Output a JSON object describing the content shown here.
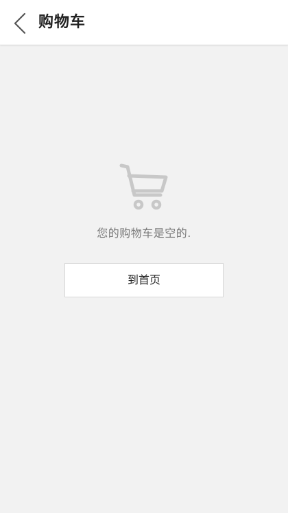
{
  "header": {
    "back_icon": "chevron-left-icon",
    "title": "购物车"
  },
  "empty_state": {
    "icon": "cart-icon",
    "message": "您的购物车是空的.",
    "home_button_label": "到首页"
  },
  "colors": {
    "page_background": "#f2f2f2",
    "header_background": "#ffffff",
    "icon_gray": "#c8c8c8",
    "text_muted": "#7a7a7a",
    "text_dark": "#222222"
  }
}
